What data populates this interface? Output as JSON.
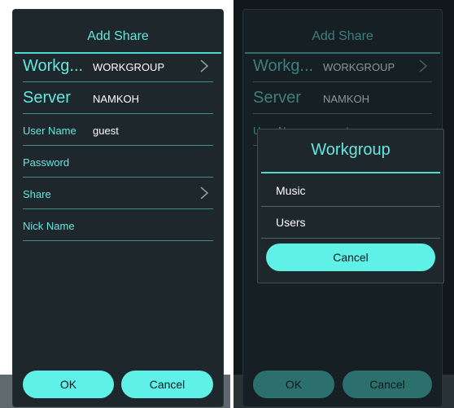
{
  "dialog": {
    "title": "Add Share",
    "workgroup_label": "Workg...",
    "workgroup_value": "WORKGROUP",
    "server_label": "Server",
    "server_value": "NAMKOH",
    "username_label": "User Name",
    "username_value": "guest",
    "password_label": "Password",
    "share_label": "Share",
    "nickname_label": "Nick Name",
    "ok_label": "OK",
    "cancel_label": "Cancel"
  },
  "dialog_right": {
    "workgroup_label": "Workg...",
    "workgroup_value": "WORKGROUP",
    "server_label": "Server",
    "server_value": "NAMKOH",
    "username_label": "User Name",
    "username_value": "guest"
  },
  "popup": {
    "title": "Workgroup",
    "options": [
      "Music",
      "Users"
    ],
    "cancel_label": "Cancel"
  },
  "colors": {
    "accent": "#66e6df",
    "button": "#5ff0e8",
    "dialog_bg": "#1d272c"
  }
}
